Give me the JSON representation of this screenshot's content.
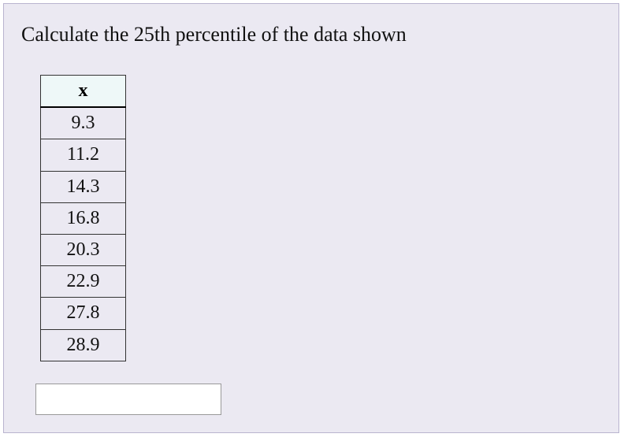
{
  "question": "Calculate the 25th percentile of the data shown",
  "table": {
    "header": "x",
    "values": [
      9.3,
      11.2,
      14.3,
      16.8,
      20.3,
      22.9,
      27.8,
      28.9
    ]
  },
  "answer": {
    "value": "",
    "placeholder": ""
  },
  "chart_data": {
    "type": "table",
    "title": "Calculate the 25th percentile of the data shown",
    "columns": [
      "x"
    ],
    "rows": [
      [
        9.3
      ],
      [
        11.2
      ],
      [
        14.3
      ],
      [
        16.8
      ],
      [
        20.3
      ],
      [
        22.9
      ],
      [
        27.8
      ],
      [
        28.9
      ]
    ]
  }
}
